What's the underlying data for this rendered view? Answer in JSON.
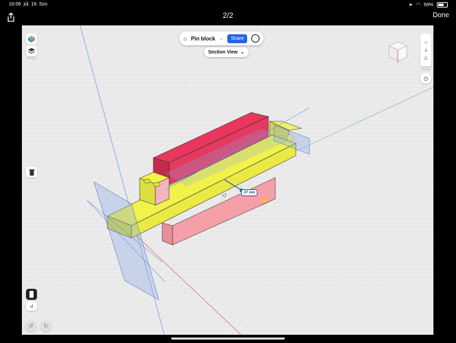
{
  "status": {
    "time": "16:06",
    "date": "júl. 19. Szo",
    "battery": "69%"
  },
  "topbar": {
    "page_indicator": "2/2",
    "done_label": "Done"
  },
  "toolbar": {
    "doc_name": "Pin block",
    "share_label": "Share",
    "view_mode": "Section View"
  },
  "viewport": {
    "dimension_label": "-37 mm"
  },
  "colors": {
    "viewport_bg": "#ececec",
    "share": "#2563eb",
    "part_red": "#e8365c",
    "part_yellow": "#f2f24a"
  }
}
